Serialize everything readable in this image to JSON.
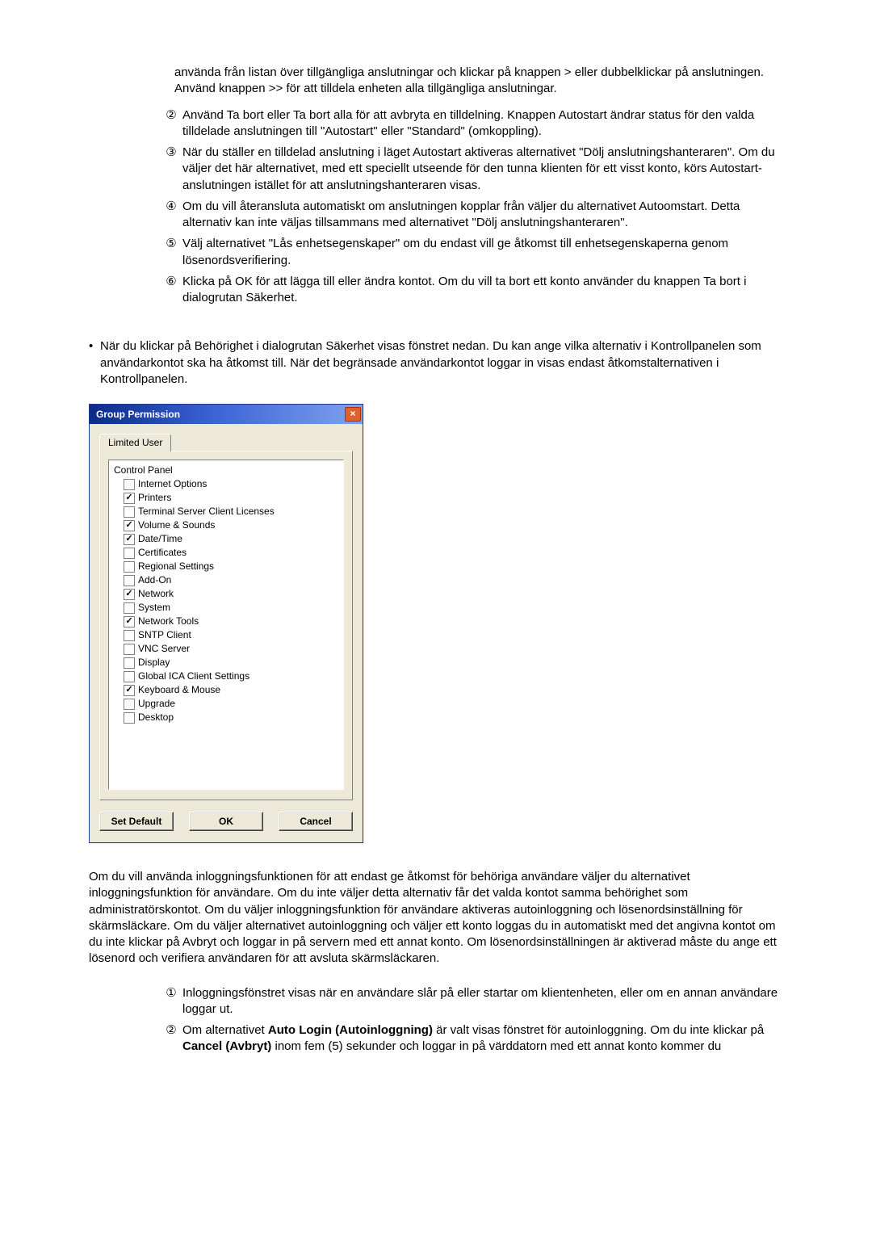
{
  "intro1_lines": [
    "använda från listan över tillgängliga anslutningar och klickar på knappen > eller dubbelklickar på anslutningen. Använd knappen >> för att tilldela enheten alla tillgängliga anslutningar."
  ],
  "list1": [
    {
      "num": "②",
      "text": "Använd Ta bort eller Ta bort alla för att avbryta en tilldelning. Knappen Autostart ändrar status för den valda tilldelade anslutningen till \"Autostart\" eller \"Standard\" (omkoppling)."
    },
    {
      "num": "③",
      "text": "När du ställer en tilldelad anslutning i läget Autostart aktiveras alternativet \"Dölj anslutningshanteraren\". Om du väljer det här alternativet, med ett speciellt utseende för den tunna klienten för ett visst konto, körs Autostart-anslutningen istället för att anslutningshanteraren visas."
    },
    {
      "num": "④",
      "text": "Om du vill återansluta automatiskt om anslutningen kopplar från väljer du alternativet Autoomstart. Detta alternativ kan inte väljas tillsammans med alternativet \"Dölj anslutningshanteraren\"."
    },
    {
      "num": "⑤",
      "text": "Välj alternativet \"Lås enhetsegenskaper\" om du endast vill ge åtkomst till enhetsegenskaperna genom lösenordsverifiering."
    },
    {
      "num": "⑥",
      "text": "Klicka på OK för att lägga till eller ändra kontot. Om du vill ta bort ett konto använder du knappen Ta bort i dialogrutan Säkerhet."
    }
  ],
  "bullet": "När du klickar på Behörighet i dialogrutan Säkerhet visas fönstret nedan. Du kan ange vilka alternativ i Kontrollpanelen som användarkontot ska ha åtkomst till. När det begränsade användarkontot loggar in visas endast åtkomstalternativen i Kontrollpanelen.",
  "dialog": {
    "title": "Group Permission",
    "tab": "Limited User",
    "root": "Control Panel",
    "items": [
      {
        "label": "Internet Options",
        "checked": false
      },
      {
        "label": "Printers",
        "checked": true
      },
      {
        "label": "Terminal Server Client Licenses",
        "checked": false
      },
      {
        "label": "Volume & Sounds",
        "checked": true
      },
      {
        "label": "Date/Time",
        "checked": true
      },
      {
        "label": "Certificates",
        "checked": false
      },
      {
        "label": "Regional Settings",
        "checked": false
      },
      {
        "label": "Add-On",
        "checked": false
      },
      {
        "label": "Network",
        "checked": true
      },
      {
        "label": "System",
        "checked": false
      },
      {
        "label": "Network Tools",
        "checked": true
      },
      {
        "label": "SNTP Client",
        "checked": false
      },
      {
        "label": "VNC Server",
        "checked": false
      },
      {
        "label": "Display",
        "checked": false
      },
      {
        "label": "Global ICA Client Settings",
        "checked": false
      },
      {
        "label": "Keyboard & Mouse",
        "checked": true
      },
      {
        "label": "Upgrade",
        "checked": false
      },
      {
        "label": "Desktop",
        "checked": false
      }
    ],
    "buttons": {
      "set_default": "Set Default",
      "ok": "OK",
      "cancel": "Cancel"
    }
  },
  "after": "Om du vill använda inloggningsfunktionen för att endast ge åtkomst för behöriga användare väljer du alternativet inloggningsfunktion för användare. Om du inte väljer detta alternativ får det valda kontot samma behörighet som administratörskontot. Om du väljer inloggningsfunktion för användare aktiveras autoinloggning och lösenordsinställning för skärmsläckare. Om du väljer alternativet autoinloggning och väljer ett konto loggas du in automatiskt med det angivna kontot om du inte klickar på Avbryt och loggar in på servern med ett annat konto. Om lösenordsinställningen är aktiverad måste du ange ett lösenord och verifiera användaren för att avsluta skärmsläckaren.",
  "list2": [
    {
      "num": "①",
      "text_plain": "Inloggningsfönstret visas när en användare slår på eller startar om klientenheten, eller om en annan användare loggar ut."
    },
    {
      "num": "②",
      "text_pre": "Om alternativet ",
      "bold1": "Auto Login (Autoinloggning)",
      "mid": " är valt visas fönstret för autoinloggning. Om du inte klickar på ",
      "bold2": "Cancel (Avbryt)",
      "text_post": " inom fem (5) sekunder och loggar in på värddatorn med ett annat konto kommer du"
    }
  ]
}
